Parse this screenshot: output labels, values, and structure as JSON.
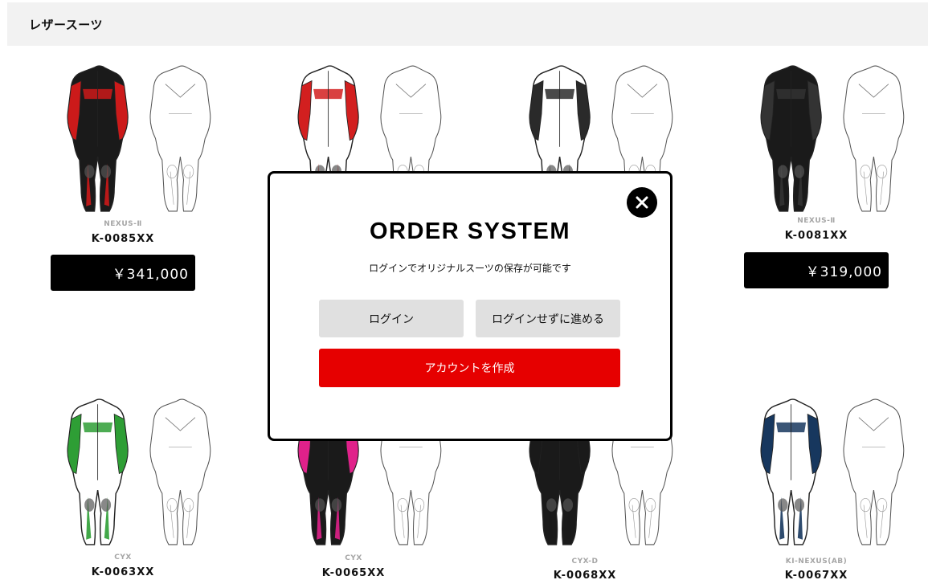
{
  "header": {
    "title": "レザースーツ"
  },
  "products": [
    {
      "series": "NEXUS-Ⅱ",
      "code": "K-0085XX",
      "price": "￥341,000",
      "accent": "#cc1a1a",
      "base": "#1a1a1a"
    },
    {
      "series": "",
      "code": "",
      "price": "",
      "accent": "#d21f1f",
      "base": "#ffffff"
    },
    {
      "series": "",
      "code": "",
      "price": "",
      "accent": "#2a2a2a",
      "base": "#ffffff"
    },
    {
      "series": "NEXUS-Ⅱ",
      "code": "K-0081XX",
      "price": "￥319,000",
      "accent": "#333333",
      "base": "#1a1a1a"
    },
    {
      "series": "CYX",
      "code": "K-0063XX",
      "accent": "#2e9e35",
      "base": "#ffffff"
    },
    {
      "series": "CYX",
      "code": "K-0065XX",
      "accent": "#e0218a",
      "base": "#1a1a1a"
    },
    {
      "series": "CYX-D",
      "code": "K-0068XX",
      "accent": "#1a1a1a",
      "base": "#1a1a1a"
    },
    {
      "series": "KI-NEXUS(AB)",
      "code": "K-0067XX",
      "accent": "#17375e",
      "base": "#ffffff"
    }
  ],
  "modal": {
    "title": "ORDER SYSTEM",
    "subtitle": "ログインでオリジナルスーツの保存が可能です",
    "login_label": "ログイン",
    "guest_label": "ログインせずに進める",
    "create_label": "アカウントを作成",
    "close_icon": "close-icon"
  }
}
